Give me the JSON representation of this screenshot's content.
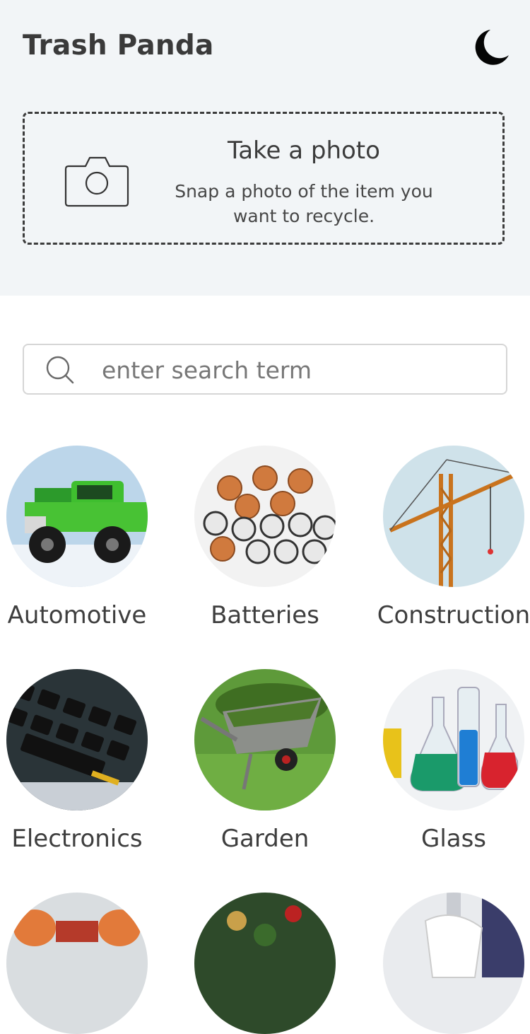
{
  "header": {
    "title": "Trash Panda",
    "theme_toggle_icon": "moon-icon"
  },
  "photo_card": {
    "title": "Take a photo",
    "subtitle": "Snap a photo of the item you want to recycle.",
    "icon": "camera-icon"
  },
  "search": {
    "placeholder": "enter search term",
    "value": "",
    "icon": "search-icon"
  },
  "categories": [
    {
      "label": "Automotive"
    },
    {
      "label": "Batteries"
    },
    {
      "label": "Construction"
    },
    {
      "label": "Electronics"
    },
    {
      "label": "Garden"
    },
    {
      "label": "Glass"
    }
  ],
  "colors": {
    "header_bg": "#f2f5f7",
    "text": "#3d3d3d",
    "border": "#d6d6d6"
  }
}
